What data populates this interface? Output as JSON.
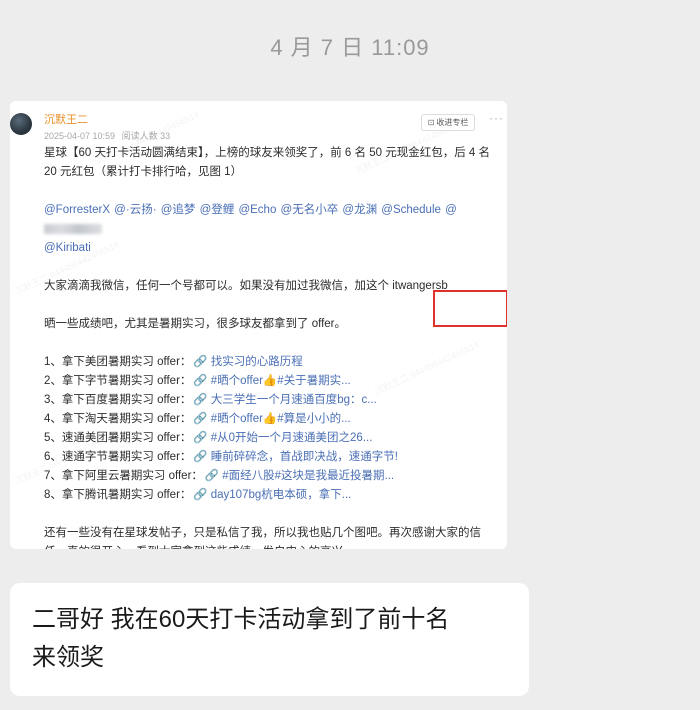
{
  "chat": {
    "timestamp": "4 月 7 日 11:09"
  },
  "post": {
    "author": "沉默王二",
    "date": "2025-04-07 10:59",
    "reads": "阅读人数 33",
    "collect_label": "收进专栏",
    "more_icon": "more-icon",
    "body_p1": "星球【60 天打卡活动圆满结束】，上榜的球友来领奖了，前 6 名 50 元现金红包，后 4 名 20 元红包（累计打卡排行哈，见图 1）",
    "mentions_line1": "@ForresterX @·云扬· @追梦 @登鲤 @Echo @无名小卒 @龙渊 @Schedule @",
    "mentions_line2": "@Kiribati",
    "body_p2": "大家滴滴我微信，任何一个号都可以。如果没有加过我微信，加这个 itwangersb",
    "body_p3": "晒一些成绩吧，尤其是暑期实习，很多球友都拿到了 offer。",
    "offers": [
      {
        "label": "1、拿下美团暑期实习 offer：",
        "link": "找实习的心路历程"
      },
      {
        "label": "2、拿下字节暑期实习 offer：",
        "link": "#晒个offer👍#关于暑期实..."
      },
      {
        "label": "3、拿下百度暑期实习 offer：",
        "link": "大三学生一个月速通百度bg：c..."
      },
      {
        "label": "4、拿下淘天暑期实习 offer：",
        "link": "#晒个offer👍#算是小小的..."
      },
      {
        "label": "5、速通美团暑期实习 offer：",
        "link": "#从0开始一个月速通美团之26..."
      },
      {
        "label": "6、速通字节暑期实习 offer：",
        "link": "睡前碎碎念，首战即决战，速通字节!"
      },
      {
        "label": "7、拿下阿里云暑期实习 offer：",
        "link": "#面经八股#这块是我最近投暑期..."
      },
      {
        "label": "8、拿下腾讯暑期实习 offer：",
        "link": "day107bg杭电本硕，拿下..."
      }
    ],
    "link_icon": "link-icon",
    "body_p4": "还有一些没有在星球发帖子，只是私信了我，所以我也贴几个图吧。再次感谢大家的信任，真的很开心，看到大家拿到这些成绩，发自内心的高兴。",
    "watermark_text": "沉默王二 644456442456514"
  },
  "message": {
    "text_line1": "二哥好 我在60天打卡活动拿到了前十名",
    "text_line2": "来领奖"
  },
  "colors": {
    "background": "#ededed",
    "author": "#e9902a",
    "link": "#4a6fb5",
    "highlight": "#e0322c"
  }
}
